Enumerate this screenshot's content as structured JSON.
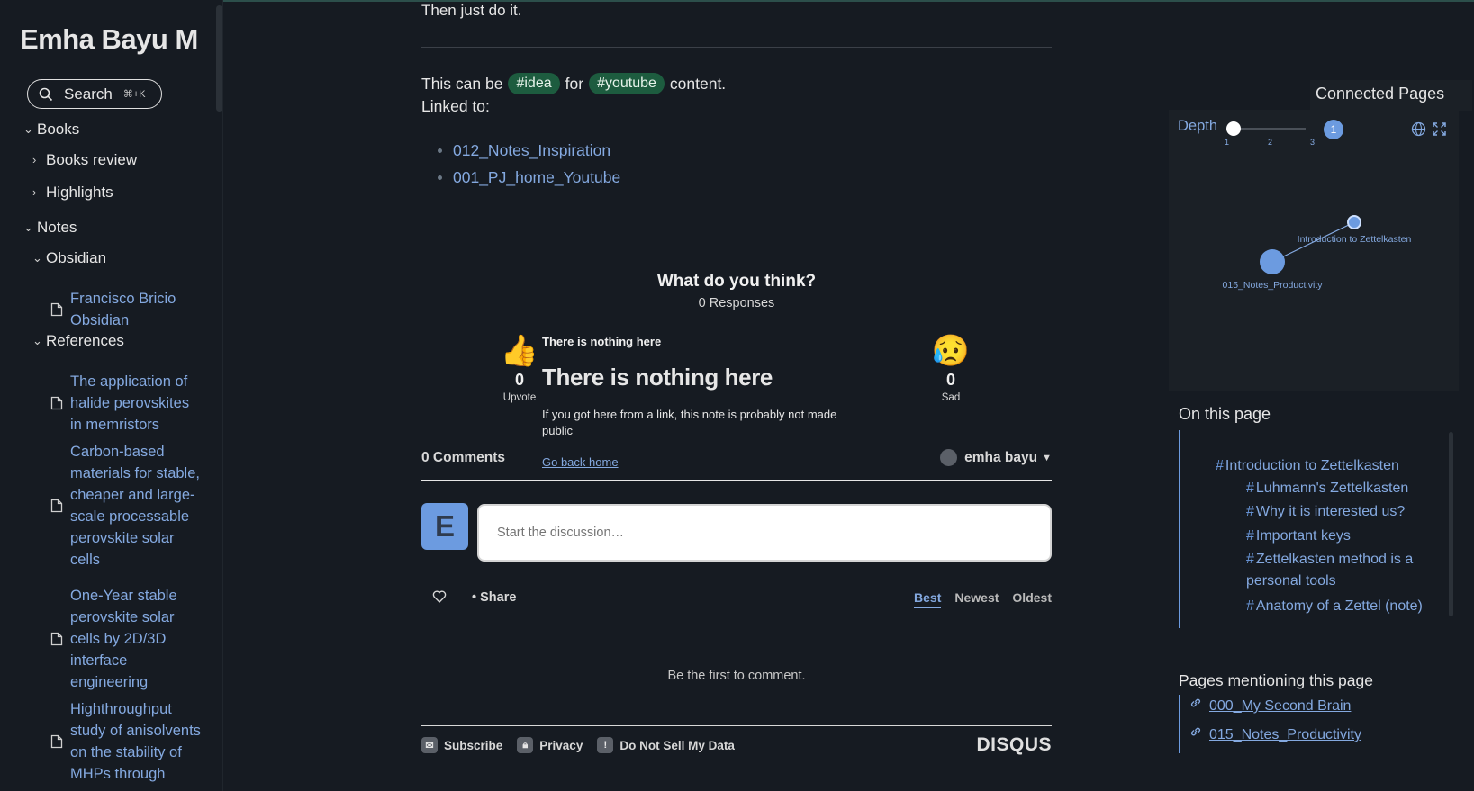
{
  "sidebar": {
    "site_title": "Emha Bayu M",
    "search_label": "Search",
    "search_shortcut": "⌘+K",
    "folders": {
      "books": "Books",
      "books_review": "Books review",
      "highlights": "Highlights",
      "notes": "Notes",
      "obsidian": "Obsidian",
      "references": "References"
    },
    "files": [
      "Francisco Bricio Obsidian",
      "The application of halide perovskites in memristors",
      "Carbon-based materials for stable, cheaper and large-scale processable perovskite solar cells",
      "One-Year stable perovskite solar cells by 2D/3D interface engineering",
      "Highthroughput study of anisolvents on the stability of MHPs through"
    ]
  },
  "content": {
    "top_line": "Then just do it.",
    "idea_prefix": "This can be",
    "tag_idea": "#idea",
    "idea_middle": "for",
    "tag_youtube": "#youtube",
    "idea_suffix": "content.",
    "linked_to": "Linked to:",
    "links": [
      "012_Notes_Inspiration",
      "001_PJ_home_Youtube"
    ]
  },
  "disqus": {
    "title": "What do you think?",
    "responses": "0 Responses",
    "reactions": [
      {
        "emoji": "👍",
        "count": "0",
        "label": "Upvote"
      },
      {
        "emoji": "😥",
        "count": "0",
        "label": "Sad"
      }
    ],
    "popover": {
      "small": "There is nothing here",
      "big": "There is nothing here",
      "text": "If you got here from a link, this note is probably not made public",
      "link": "Go back home"
    },
    "comments_count": "0 Comments",
    "user_name": "emha bayu",
    "avatar_letter": "E",
    "comment_placeholder": "Start the discussion…",
    "share_label": "Share",
    "sort": [
      "Best",
      "Newest",
      "Oldest"
    ],
    "sort_active": "Best",
    "empty_text": "Be the first to comment.",
    "footer": {
      "subscribe": "Subscribe",
      "privacy": "Privacy",
      "do_not_sell": "Do Not Sell My Data",
      "logo": "DISQUS"
    }
  },
  "graph": {
    "title": "Connected Pages",
    "depth_label": "Depth",
    "depth_ticks": [
      "1",
      "2",
      "3"
    ],
    "depth_value": "1",
    "nodes": [
      "Introduction to Zettelkasten",
      "015_Notes_Productivity"
    ]
  },
  "toc": {
    "title": "On this page",
    "items": [
      "Introduction to Zettelkasten",
      "Luhmann's Zettelkasten",
      "Why it is interested us?",
      "Important keys",
      "Zettelkasten method is a personal tools",
      "Anatomy of a Zettel (note)"
    ]
  },
  "backlinks": {
    "title": "Pages mentioning this page",
    "items": [
      "000_My Second Brain",
      "015_Notes_Productivity"
    ]
  },
  "colors": {
    "background": "#161b22",
    "accent": "#84a9e0",
    "tag_bg": "#1d5c3f"
  }
}
